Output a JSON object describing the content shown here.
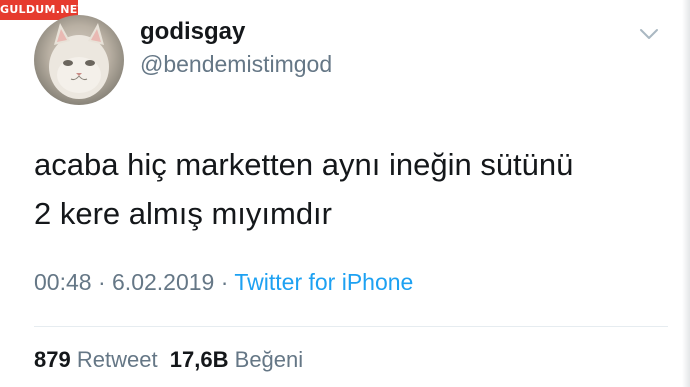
{
  "watermark": "GULDUM.NET",
  "user": {
    "display_name": "godisgay",
    "handle": "@bendemistimgod"
  },
  "tweet": {
    "lines": [
      "acaba hiç marketten aynı ineğin sütünü",
      "2 kere almış mıyımdır"
    ]
  },
  "meta": {
    "time": "00:48",
    "separator": " · ",
    "date": "6.02.2019",
    "source": "Twitter for iPhone"
  },
  "stats": {
    "retweet_count": "879",
    "retweet_label": "Retweet",
    "like_count": "17,6B",
    "like_label": "Beğeni"
  },
  "colors": {
    "text": "#14171a",
    "secondary": "#657786",
    "link": "#1da1f2",
    "divider": "#e6ecf0"
  },
  "icons": {
    "menu": "chevron-down-icon"
  }
}
